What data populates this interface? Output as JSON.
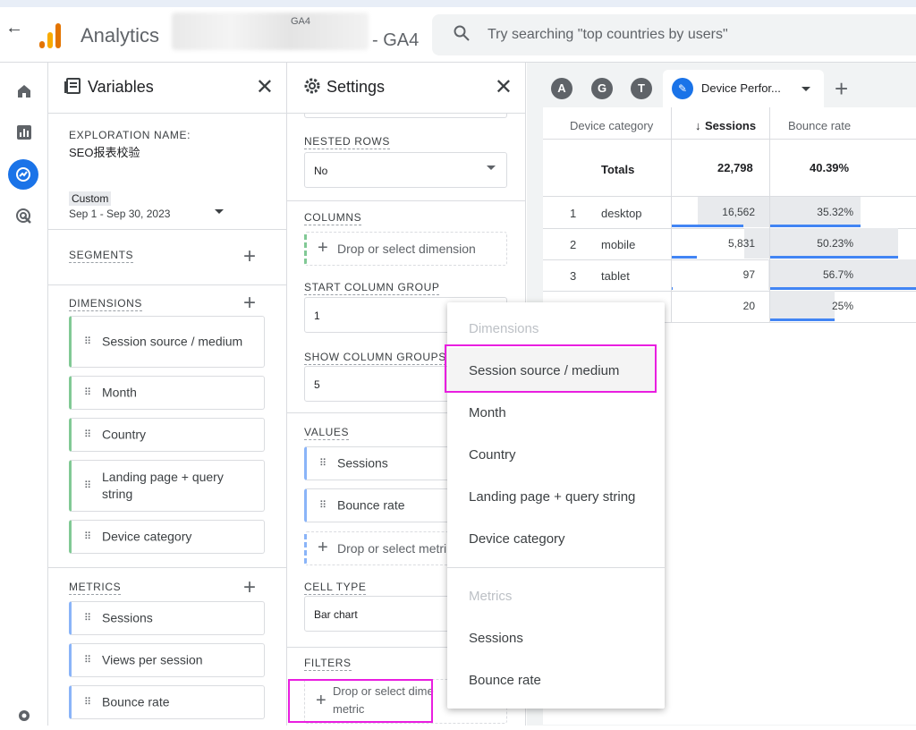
{
  "topbar": {
    "back_icon": "arrow-back-icon",
    "app_name": "Analytics",
    "property_small": "GA4",
    "property_suffix": "- GA4",
    "search_placeholder": "Try searching \"top countries by users\""
  },
  "rail": [
    "home-icon",
    "reports-icon",
    "explore-icon",
    "advertising-icon",
    "settings-icon"
  ],
  "variables": {
    "title": "Variables",
    "exploration_name_label": "EXPLORATION NAME:",
    "exploration_name": "SEO报表校验",
    "date_label": "Custom",
    "date_range": "Sep 1 - Sep 30, 2023",
    "segments_label": "SEGMENTS",
    "dimensions_label": "DIMENSIONS",
    "dimensions": [
      "Session source / medium",
      "Month",
      "Country",
      "Landing page + query string",
      "Device category"
    ],
    "metrics_label": "METRICS",
    "metrics": [
      "Sessions",
      "Views per session",
      "Bounce rate"
    ]
  },
  "settings": {
    "title": "Settings",
    "nested_rows_label": "NESTED ROWS",
    "nested_rows_value": "No",
    "columns_label": "COLUMNS",
    "columns_drop": "Drop or select dimension",
    "start_column_group_label": "START COLUMN GROUP",
    "start_column_group_value": "1",
    "show_column_groups_label": "SHOW COLUMN GROUPS",
    "show_column_groups_value": "5",
    "values_label": "VALUES",
    "values": [
      "Sessions",
      "Bounce rate"
    ],
    "values_drop": "Drop or select metri",
    "cell_type_label": "CELL TYPE",
    "cell_type_value": "Bar chart",
    "filters_label": "FILTERS",
    "filters_drop_line1": "Drop or select dime",
    "filters_drop_line2": "metric"
  },
  "tabs": {
    "avatars": [
      "A",
      "G",
      "T"
    ],
    "active_tab": "Device Perfor...",
    "add": "+"
  },
  "table": {
    "headers": [
      "Device category",
      "Sessions",
      "Bounce rate"
    ],
    "sort_arrow": "↓",
    "totals_label": "Totals",
    "totals_sessions": "22,798",
    "totals_bounce": "40.39%",
    "rows": [
      {
        "index": "1",
        "device": "desktop",
        "sessions": "16,562",
        "bounce": "35.32%",
        "sessions_share": 0.73,
        "bounce_share": 0.62
      },
      {
        "index": "2",
        "device": "mobile",
        "sessions": "5,831",
        "bounce": "50.23%",
        "sessions_share": 0.26,
        "bounce_share": 0.88
      },
      {
        "index": "3",
        "device": "tablet",
        "sessions": "97",
        "bounce": "56.7%",
        "sessions_share": 0.01,
        "bounce_share": 1.0
      },
      {
        "index": "",
        "device": "",
        "sessions": "20",
        "bounce": "25%",
        "sessions_share": 0.0,
        "bounce_share": 0.44
      }
    ]
  },
  "popup": {
    "dimensions_header": "Dimensions",
    "dimensions": [
      "Session source / medium",
      "Month",
      "Country",
      "Landing page + query string",
      "Device category"
    ],
    "metrics_header": "Metrics",
    "metrics": [
      "Sessions",
      "Bounce rate"
    ]
  },
  "colors": {
    "accent": "#1a73e8",
    "highlight": "#e91ee0",
    "dim_chip": "#81c995",
    "metric_chip": "#8ab4f8"
  }
}
